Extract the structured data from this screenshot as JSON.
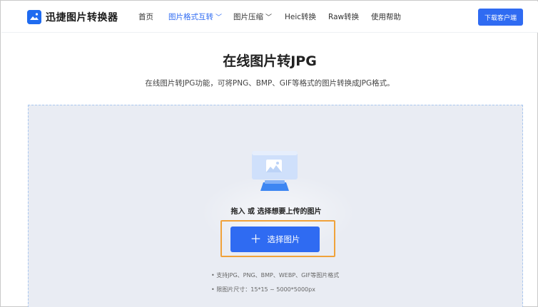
{
  "app": {
    "name": "迅捷图片转换器"
  },
  "nav": {
    "items": [
      {
        "label": "首页",
        "active": false,
        "dropdown": false
      },
      {
        "label": "图片格式互转",
        "active": true,
        "dropdown": true
      },
      {
        "label": "图片压缩",
        "active": false,
        "dropdown": true
      },
      {
        "label": "Heic转换",
        "active": false,
        "dropdown": false
      },
      {
        "label": "Raw转换",
        "active": false,
        "dropdown": false
      },
      {
        "label": "使用帮助",
        "active": false,
        "dropdown": false
      }
    ],
    "cta_label": "下载客户端"
  },
  "page": {
    "title": "在线图片转JPG",
    "subtitle": "在线图片转JPG功能，可将PNG、BMP、GIF等格式的图片转换成JPG格式。"
  },
  "upload": {
    "prompt": "拖入 或 选择想要上传的图片",
    "button_label": "选择图片",
    "notes": [
      "• 支持JPG、PNG、BMP、WEBP、GIF等图片格式",
      "• 限图片尺寸：15*15 ~ 5000*5000px"
    ]
  },
  "colors": {
    "accent": "#2f6bf2",
    "highlight": "#f0a23a",
    "dropzone_bg": "#e9ecf3"
  }
}
